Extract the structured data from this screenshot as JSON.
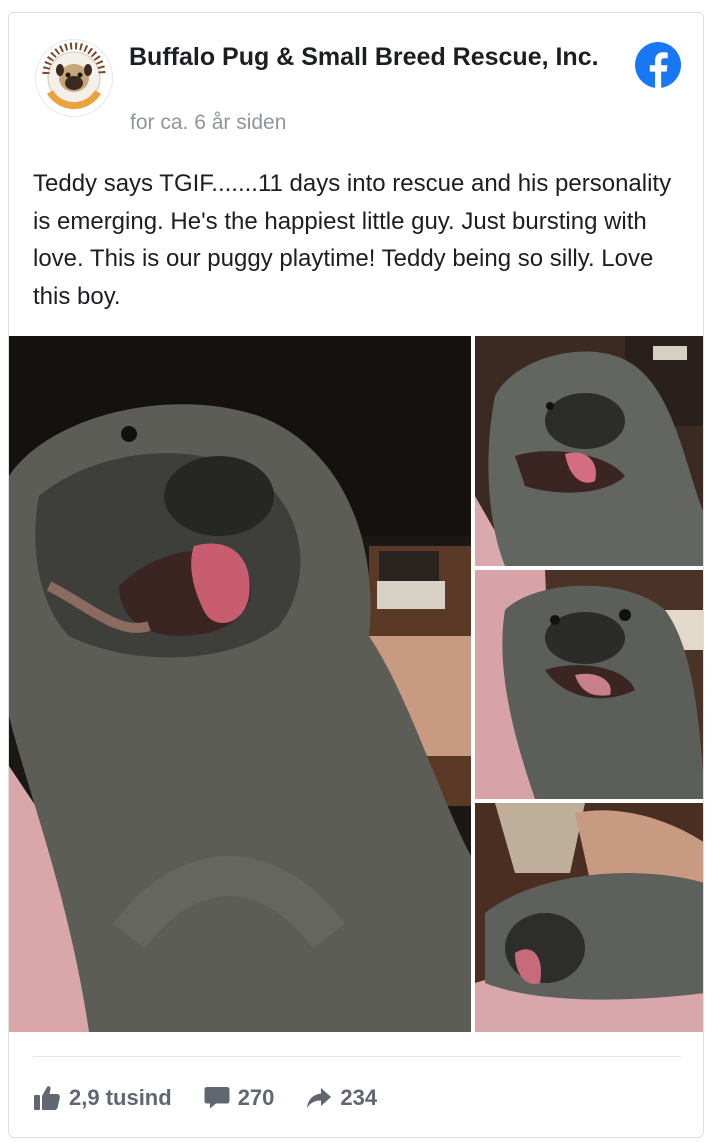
{
  "post": {
    "page_name": "Buffalo Pug & Small Breed Rescue, Inc.",
    "timestamp": "for ca. 6 år siden",
    "text": "Teddy says TGIF.......11 days into rescue and his personality is emerging. He's the happiest little guy. Just bursting with love. This is our puggy playtime! Teddy being so silly. Love this boy.",
    "avatar_logo": {
      "top_text": "Buffalo Pug and Small Breed",
      "bottom_text": "Rescue"
    }
  },
  "photos": [
    {
      "icon": "pug-photo-main"
    },
    {
      "icon": "pug-photo-thumbnail"
    },
    {
      "icon": "pug-photo-thumbnail"
    },
    {
      "icon": "pug-photo-thumbnail"
    }
  ],
  "stats": {
    "likes": "2,9 tusind",
    "comments": "270",
    "shares": "234"
  },
  "colors": {
    "facebook_blue": "#1877f2",
    "secondary_text": "#90949c",
    "stat_text": "#606770",
    "border": "#dddfe2"
  }
}
